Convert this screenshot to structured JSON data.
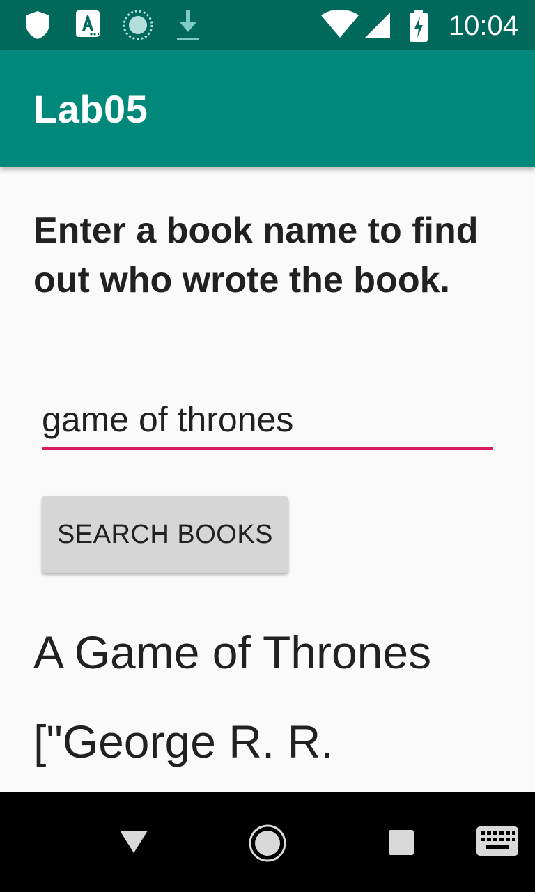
{
  "status_bar": {
    "time": "10:04",
    "icons": [
      "shield-icon",
      "keyboard-a-icon",
      "sync-icon",
      "download-icon",
      "wifi-icon",
      "cell-signal-icon",
      "battery-charging-icon"
    ]
  },
  "app_bar": {
    "title": "Lab05"
  },
  "main": {
    "instructions": "Enter a book name to find out who wrote the book.",
    "book_input": {
      "value": "game of thrones",
      "placeholder": ""
    },
    "search_button_label": "SEARCH BOOKS",
    "result_title": "A Game of Thrones",
    "result_authors": "[\"George R. R."
  },
  "nav_bar": {
    "icons": [
      "back-icon",
      "home-icon",
      "recents-icon",
      "keyboard-icon"
    ]
  },
  "colors": {
    "status_bar": "#00695c",
    "app_bar": "#00897b",
    "input_underline": "#d81b60",
    "button_bg": "#d6d6d6",
    "background": "#fafafa"
  }
}
